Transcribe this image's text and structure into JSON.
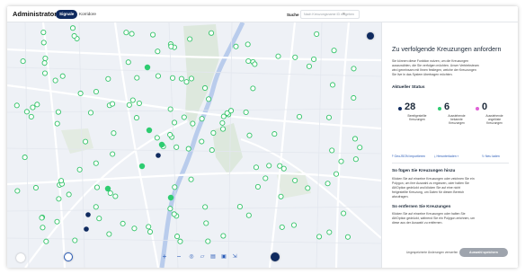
{
  "header": {
    "app_title": "Administrator",
    "tabs": [
      {
        "label": "Signale",
        "active": true
      },
      {
        "label": "Korridore",
        "active": false
      }
    ],
    "search_label": "Suche",
    "search_placeholder": "Nach Kreuzungsname ID eingeben",
    "clear_icon": "×"
  },
  "panel": {
    "title": "Zu verfolgende Kreuzungen anfordern",
    "intro_lines": [
      "Sie können diese Funktion nutzen, um die Kreuzungen",
      "auszuwählen, die Sie verfolgen möchten. Unser Vertriebsteam",
      "wird geneinsam mit Ihnen festlegen, welche der Kreuzungen",
      "Sie live in das System übertragen möchten."
    ],
    "status_heading": "Aktueller Status",
    "stats": [
      {
        "value": "28",
        "label_lines": [
          "Bereitgestellte",
          "Kreuzungen"
        ],
        "color": "#0f2a5f"
      },
      {
        "value": "6",
        "label_lines": [
          "Ausstehende",
          "bekannte",
          "Kreuzungen"
        ],
        "color": "#2ecc71"
      },
      {
        "value": "0",
        "label_lines": [
          "Ausstehende",
          "ungelöste",
          "Kreuzungen"
        ],
        "color": "#e060d6"
      }
    ],
    "actions": [
      {
        "label": "GeoJSON importieren",
        "icon": "upload-icon"
      },
      {
        "label": "Herunterladen ▾",
        "icon": "download-icon"
      },
      {
        "label": "Neu laden",
        "icon": "refresh-icon"
      }
    ],
    "add_heading": "So fügen Sie Kreuzungen hinzu",
    "add_lines": [
      "Klicken Sie auf einzelne Kreuzungen oder zeichnen Sie ein",
      "Polygon, um ihre Auswahl zu ergänzen, oder halten Sie",
      "Alt/Option gedrückt und klicken Sie auf eine nicht",
      "freigestellte Kreuzung, um Daten für diesen Bereich",
      "abzufragen."
    ],
    "remove_heading": "So entfernen Sie Kreuzungen",
    "remove_lines": [
      "Klicken Sie auf einzelne Kreuzungen oder halten Sie",
      "Alt/Option gedrückt, während Sie ein Polygon zeichnen, um",
      "diese aus der Auswahl zu entfernen."
    ],
    "undo_label": "Ungespeicherte Änderungen verwerfen",
    "save_label": "Auswahl speichern"
  },
  "map": {
    "toolbar": [
      {
        "label": "+",
        "icon": "zoom-in-icon"
      },
      {
        "label": "−",
        "icon": "zoom-out-icon"
      },
      {
        "label": "◎",
        "icon": "locate-icon"
      },
      {
        "label": "▱",
        "icon": "polygon-icon"
      },
      {
        "label": "▤",
        "icon": "layers-icon"
      },
      {
        "label": "▣",
        "icon": "select-icon"
      },
      {
        "label": "⇲",
        "icon": "expand-icon"
      }
    ],
    "colors": {
      "deployed": "#0f2a5f",
      "pending_known": "#2ecc71",
      "pending_unknown": "#e060d6",
      "unselected_ring": "#35c46a"
    }
  }
}
